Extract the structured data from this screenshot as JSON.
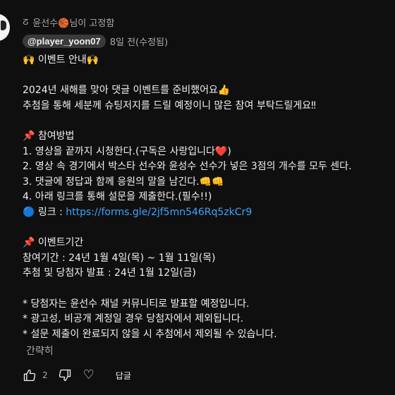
{
  "pinned_label": "윤선수🏀님이 고정함",
  "comment": {
    "author_handle": "@player_yoon07",
    "timestamp": "8일 전(수정됨)",
    "lines": [
      "🙌 이벤트 안내🙌",
      "",
      "2024년 새해를 맞아 댓글 이벤트를 준비했어요👍",
      "추첨을 통해 세분께 슈팅저지를 드릴 예정이니 많은 참여 부탁드릴게요‼",
      "",
      "📌 참여방법",
      "1. 영상을 끝까지 시청한다.(구독은 사랑입니다❤️)",
      "2. 영상 속 경기에서 박스타 선수와 윤성수 선수가 넣은 3점의 개수를 모두 센다.",
      "3. 댓글에 정답과 함께 응원의 말을 남긴다.👊👊",
      "4. 아래 링크를 통해 설문을 제출한다.(필수!!)",
      null,
      "",
      "📌 이벤트기간",
      "참여기간 : 24년 1월 4일(목) ~ 1월 11일(목)",
      "추첨 및 당첨자 발표 : 24년 1월 12일(금)",
      "",
      "* 당첨자는 윤선수 채널 커뮤니티로 발표할 예정입니다.",
      "* 광고성, 비공개 계정일 경우 당첨자에서 제외됩니다.",
      "* 설문 제출이 완료되지 않을 시 추첨에서 제외될 수 있습니다."
    ],
    "link_prefix": "🔵 링크 : ",
    "link_url": "https://forms.gle/2jf5mn546Rq5zkCr9",
    "collapse_label": "간략히"
  },
  "actions": {
    "like_count": "2",
    "reply_label": "답글"
  },
  "icons": {
    "pin": "pin-icon",
    "like": "thumbs-up-icon",
    "dislike": "thumbs-down-icon",
    "heart": "heart-icon"
  }
}
